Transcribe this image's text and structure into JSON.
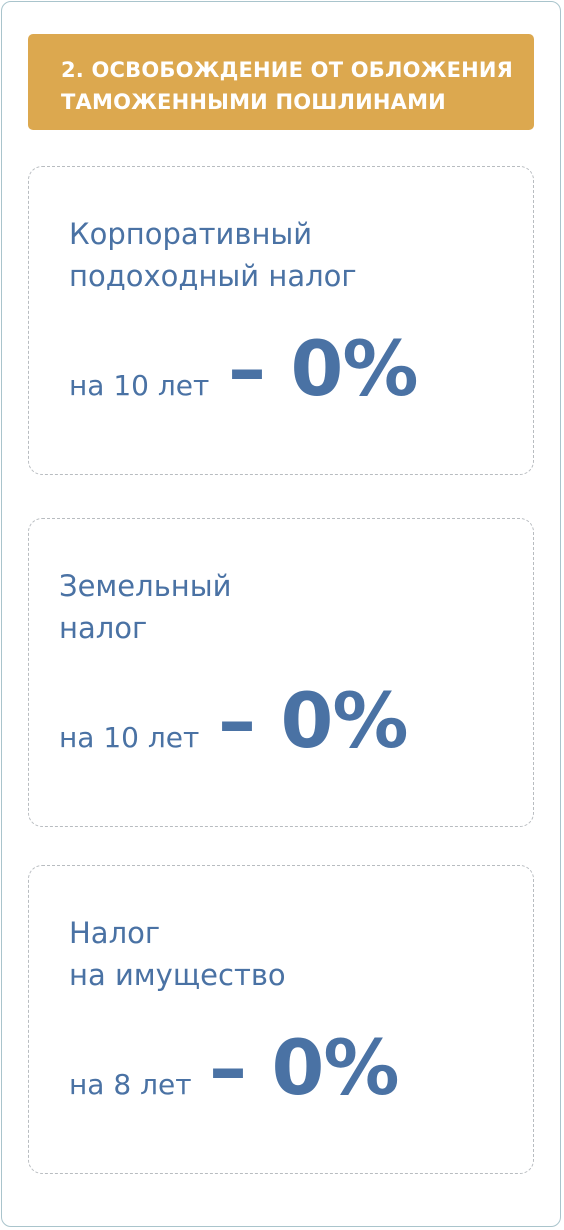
{
  "banner": {
    "line1": "2. ОСВОБОЖДЕНИЕ ОТ ОБЛОЖЕНИЯ",
    "line2": "ТАМОЖЕННЫМИ ПОШЛИНАМИ"
  },
  "cards": [
    {
      "title_line1": "Корпоративный",
      "title_line2": "подоходный налог",
      "duration": "на 10 лет",
      "rate": "– 0%"
    },
    {
      "title_line1": "Земельный",
      "title_line2": "налог",
      "duration": "на 10 лет",
      "rate": "– 0%"
    },
    {
      "title_line1": "Налог",
      "title_line2": "на имущество",
      "duration": "на 8 лет",
      "rate": "– 0%"
    }
  ],
  "colors": {
    "banner_bg": "#dca84f",
    "text_blue": "#4a72a4",
    "frame_border": "#a9c4cc",
    "card_border": "#b8bcc0"
  }
}
